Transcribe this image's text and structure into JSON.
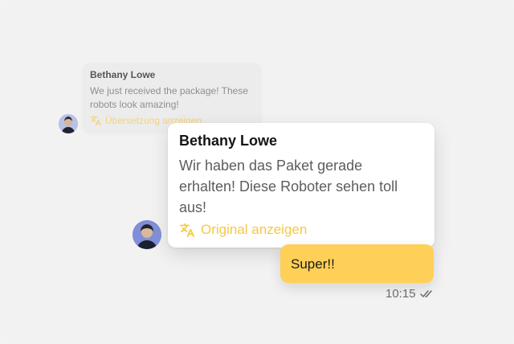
{
  "background_message": {
    "sender": "Bethany Lowe",
    "text": "We just received the package! These robots look amazing!",
    "translation_link": "Übersetzung anzeigen"
  },
  "translated_message": {
    "sender": "Bethany Lowe",
    "text": "Wir haben das Paket gerade erhalten! Diese Roboter sehen toll aus!",
    "original_link": "Original anzeigen"
  },
  "reply": {
    "text": "Super!!",
    "time": "10:15",
    "status_icon": "double-check-icon"
  },
  "icons": {
    "translate": "translate-icon"
  },
  "colors": {
    "accent_yellow": "#ffd057",
    "link_yellow": "#f6c842",
    "canvas": "#f2f2f2"
  }
}
